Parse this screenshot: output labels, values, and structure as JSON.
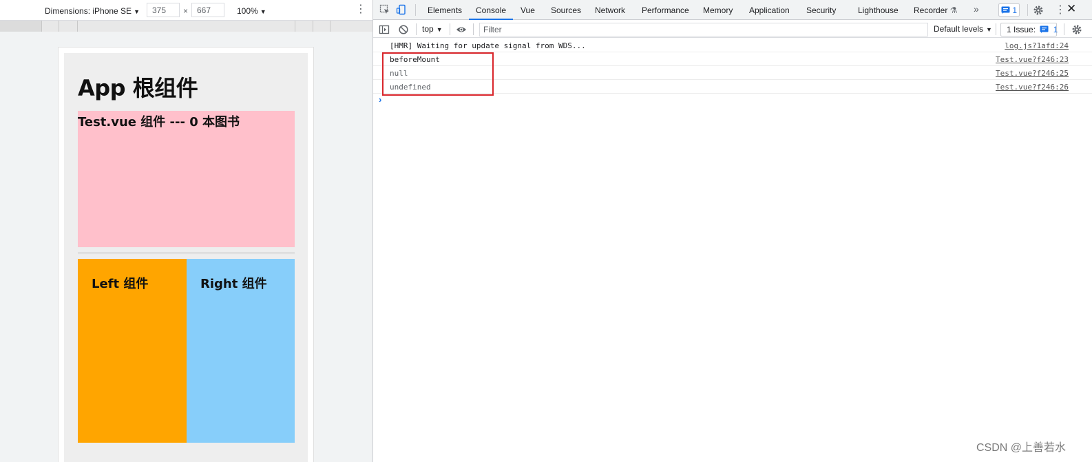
{
  "device_toolbar": {
    "dimensions_label": "Dimensions: iPhone SE",
    "width_value": "375",
    "times": "×",
    "height_value": "667",
    "zoom": "100%"
  },
  "app": {
    "title": "App 根组件",
    "test_title": "Test.vue 组件 --- 0 本图书",
    "left_label": "Left 组件",
    "right_label": "Right 组件",
    "colors": {
      "test_bg": "#ffc0cb",
      "left_bg": "#ffa500",
      "right_bg": "#87cefa"
    }
  },
  "devtools": {
    "tabs": [
      {
        "label": "Elements",
        "active": false
      },
      {
        "label": "Console",
        "active": true
      },
      {
        "label": "Vue",
        "active": false
      },
      {
        "label": "Sources",
        "active": false
      },
      {
        "label": "Network",
        "active": false
      },
      {
        "label": "Performance",
        "active": false
      },
      {
        "label": "Memory",
        "active": false
      },
      {
        "label": "Application",
        "active": false
      },
      {
        "label": "Security",
        "active": false
      },
      {
        "label": "Lighthouse",
        "active": false
      },
      {
        "label": "Recorder",
        "active": false
      }
    ],
    "more_tabs": "»",
    "issue_badge_count": "1",
    "console_toolbar": {
      "context": "top",
      "filter_placeholder": "Filter",
      "levels": "Default levels",
      "issues_label": "1 Issue:",
      "issues_count": "1"
    },
    "logs": [
      {
        "message": "[HMR] Waiting for update signal from WDS...",
        "source": "log.js?1afd:24",
        "dim": false
      },
      {
        "message": "beforeMount",
        "source": "Test.vue?f246:23",
        "dim": false
      },
      {
        "message": "null",
        "source": "Test.vue?f246:25",
        "dim": true
      },
      {
        "message": "undefined",
        "source": "Test.vue?f246:26",
        "dim": true
      }
    ],
    "accent_color": "#1a73e8"
  },
  "watermark": "CSDN @上善若水"
}
